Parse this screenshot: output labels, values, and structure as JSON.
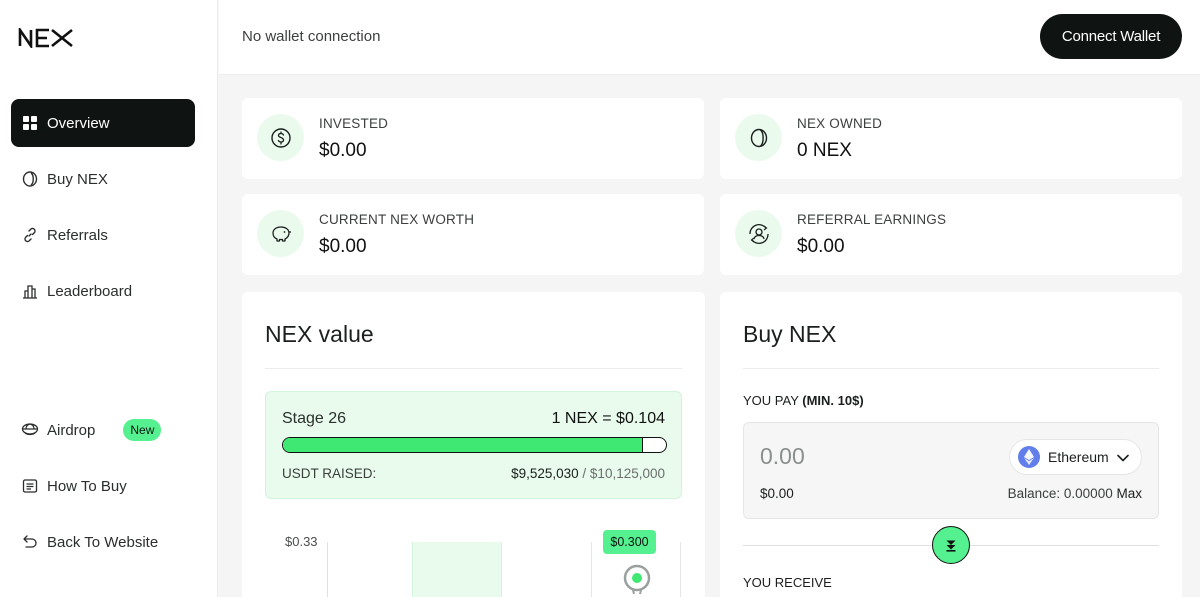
{
  "brand": {
    "logo_text": "NEX"
  },
  "header": {
    "wallet_status": "No wallet connection",
    "connect_label": "Connect Wallet"
  },
  "sidebar": {
    "items": [
      {
        "label": "Overview",
        "icon": "grid-icon",
        "active": true
      },
      {
        "label": "Buy NEX",
        "icon": "coin-icon"
      },
      {
        "label": "Referrals",
        "icon": "link-icon"
      },
      {
        "label": "Leaderboard",
        "icon": "bar-chart-icon"
      },
      {
        "label": "Airdrop",
        "icon": "parachute-icon",
        "badge": "New"
      },
      {
        "label": "How To Buy",
        "icon": "document-icon"
      },
      {
        "label": "Back To Website",
        "icon": "back-arrow-icon"
      }
    ]
  },
  "stats": [
    {
      "label": "INVESTED",
      "value": "$0.00",
      "icon": "dollar-icon"
    },
    {
      "label": "NEX OWNED",
      "value": "0 NEX",
      "icon": "coin-icon"
    },
    {
      "label": "CURRENT NEX WORTH",
      "value": "$0.00",
      "icon": "piggy-bank-icon"
    },
    {
      "label": "REFERRAL EARNINGS",
      "value": "$0.00",
      "icon": "referral-cycle-icon"
    }
  ],
  "nex_value": {
    "title": "NEX value",
    "stage": "Stage 26",
    "price": "1 NEX = $0.104",
    "progress": 0.94,
    "raised_label": "USDT RAISED:",
    "raised": "$9,525,030",
    "target": "/ $10,125,000",
    "chart_axis_label": "$0.33",
    "chart_tag": "$0.300"
  },
  "buy": {
    "title": "Buy NEX",
    "pay_label": "YOU PAY",
    "pay_min": "(MIN. 10$)",
    "pay_placeholder": "0.00",
    "pay_usd": "$0.00",
    "token": "Ethereum",
    "balance": "Balance: 0.00000",
    "max_label": "Max",
    "receive_label": "YOU RECEIVE"
  },
  "colors": {
    "accent": "#55f08f",
    "dark": "#0f1412",
    "mint": "#e8fbed"
  }
}
